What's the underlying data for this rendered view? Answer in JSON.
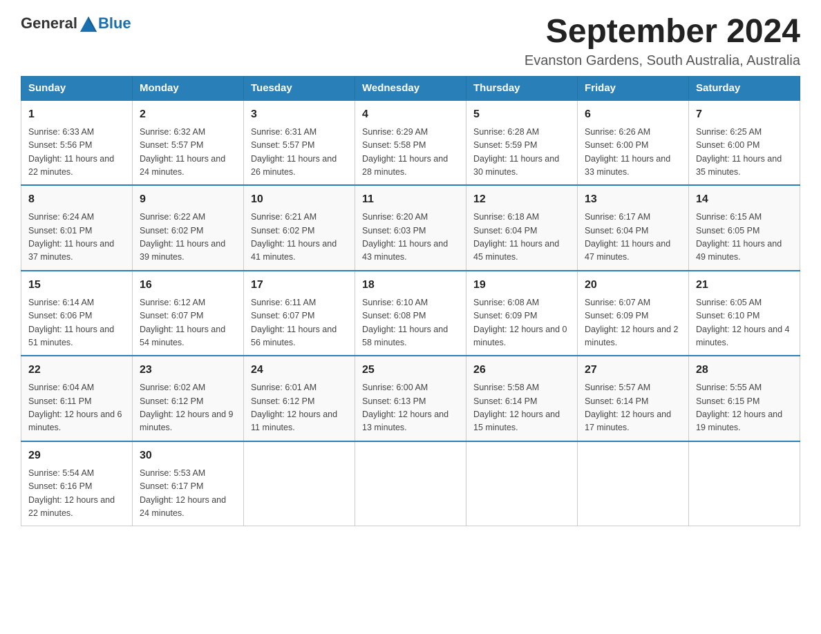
{
  "header": {
    "logo_general": "General",
    "logo_blue": "Blue",
    "month": "September 2024",
    "location": "Evanston Gardens, South Australia, Australia"
  },
  "days_of_week": [
    "Sunday",
    "Monday",
    "Tuesday",
    "Wednesday",
    "Thursday",
    "Friday",
    "Saturday"
  ],
  "weeks": [
    [
      {
        "day": "1",
        "sunrise": "6:33 AM",
        "sunset": "5:56 PM",
        "daylight": "11 hours and 22 minutes."
      },
      {
        "day": "2",
        "sunrise": "6:32 AM",
        "sunset": "5:57 PM",
        "daylight": "11 hours and 24 minutes."
      },
      {
        "day": "3",
        "sunrise": "6:31 AM",
        "sunset": "5:57 PM",
        "daylight": "11 hours and 26 minutes."
      },
      {
        "day": "4",
        "sunrise": "6:29 AM",
        "sunset": "5:58 PM",
        "daylight": "11 hours and 28 minutes."
      },
      {
        "day": "5",
        "sunrise": "6:28 AM",
        "sunset": "5:59 PM",
        "daylight": "11 hours and 30 minutes."
      },
      {
        "day": "6",
        "sunrise": "6:26 AM",
        "sunset": "6:00 PM",
        "daylight": "11 hours and 33 minutes."
      },
      {
        "day": "7",
        "sunrise": "6:25 AM",
        "sunset": "6:00 PM",
        "daylight": "11 hours and 35 minutes."
      }
    ],
    [
      {
        "day": "8",
        "sunrise": "6:24 AM",
        "sunset": "6:01 PM",
        "daylight": "11 hours and 37 minutes."
      },
      {
        "day": "9",
        "sunrise": "6:22 AM",
        "sunset": "6:02 PM",
        "daylight": "11 hours and 39 minutes."
      },
      {
        "day": "10",
        "sunrise": "6:21 AM",
        "sunset": "6:02 PM",
        "daylight": "11 hours and 41 minutes."
      },
      {
        "day": "11",
        "sunrise": "6:20 AM",
        "sunset": "6:03 PM",
        "daylight": "11 hours and 43 minutes."
      },
      {
        "day": "12",
        "sunrise": "6:18 AM",
        "sunset": "6:04 PM",
        "daylight": "11 hours and 45 minutes."
      },
      {
        "day": "13",
        "sunrise": "6:17 AM",
        "sunset": "6:04 PM",
        "daylight": "11 hours and 47 minutes."
      },
      {
        "day": "14",
        "sunrise": "6:15 AM",
        "sunset": "6:05 PM",
        "daylight": "11 hours and 49 minutes."
      }
    ],
    [
      {
        "day": "15",
        "sunrise": "6:14 AM",
        "sunset": "6:06 PM",
        "daylight": "11 hours and 51 minutes."
      },
      {
        "day": "16",
        "sunrise": "6:12 AM",
        "sunset": "6:07 PM",
        "daylight": "11 hours and 54 minutes."
      },
      {
        "day": "17",
        "sunrise": "6:11 AM",
        "sunset": "6:07 PM",
        "daylight": "11 hours and 56 minutes."
      },
      {
        "day": "18",
        "sunrise": "6:10 AM",
        "sunset": "6:08 PM",
        "daylight": "11 hours and 58 minutes."
      },
      {
        "day": "19",
        "sunrise": "6:08 AM",
        "sunset": "6:09 PM",
        "daylight": "12 hours and 0 minutes."
      },
      {
        "day": "20",
        "sunrise": "6:07 AM",
        "sunset": "6:09 PM",
        "daylight": "12 hours and 2 minutes."
      },
      {
        "day": "21",
        "sunrise": "6:05 AM",
        "sunset": "6:10 PM",
        "daylight": "12 hours and 4 minutes."
      }
    ],
    [
      {
        "day": "22",
        "sunrise": "6:04 AM",
        "sunset": "6:11 PM",
        "daylight": "12 hours and 6 minutes."
      },
      {
        "day": "23",
        "sunrise": "6:02 AM",
        "sunset": "6:12 PM",
        "daylight": "12 hours and 9 minutes."
      },
      {
        "day": "24",
        "sunrise": "6:01 AM",
        "sunset": "6:12 PM",
        "daylight": "12 hours and 11 minutes."
      },
      {
        "day": "25",
        "sunrise": "6:00 AM",
        "sunset": "6:13 PM",
        "daylight": "12 hours and 13 minutes."
      },
      {
        "day": "26",
        "sunrise": "5:58 AM",
        "sunset": "6:14 PM",
        "daylight": "12 hours and 15 minutes."
      },
      {
        "day": "27",
        "sunrise": "5:57 AM",
        "sunset": "6:14 PM",
        "daylight": "12 hours and 17 minutes."
      },
      {
        "day": "28",
        "sunrise": "5:55 AM",
        "sunset": "6:15 PM",
        "daylight": "12 hours and 19 minutes."
      }
    ],
    [
      {
        "day": "29",
        "sunrise": "5:54 AM",
        "sunset": "6:16 PM",
        "daylight": "12 hours and 22 minutes."
      },
      {
        "day": "30",
        "sunrise": "5:53 AM",
        "sunset": "6:17 PM",
        "daylight": "12 hours and 24 minutes."
      },
      null,
      null,
      null,
      null,
      null
    ]
  ],
  "labels": {
    "sunrise_prefix": "Sunrise: ",
    "sunset_prefix": "Sunset: ",
    "daylight_prefix": "Daylight: "
  }
}
